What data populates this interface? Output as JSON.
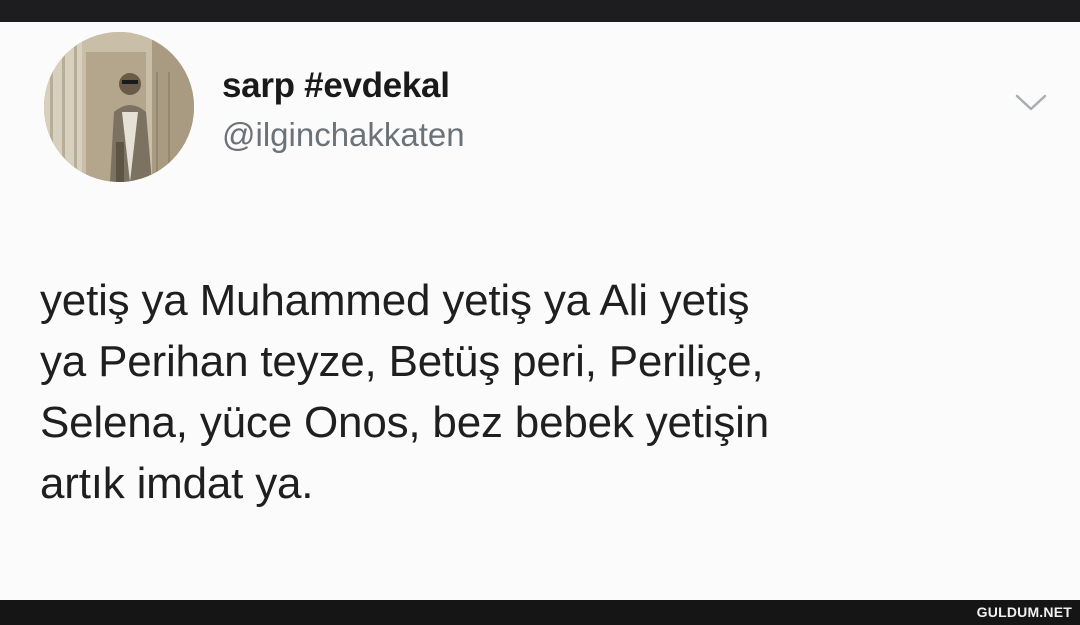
{
  "tweet": {
    "author": {
      "display_name": "sarp #evdekal",
      "handle": "@ilginchakkaten"
    },
    "menu_icon": "chevron-down-icon",
    "text_lines": [
      "yetiş ya Muhammed yetiş ya Ali yetiş",
      "ya Perihan teyze, Betüş peri, Periliçe,",
      "Selena, yüce Onos, bez bebek yetişin",
      "artık imdat ya."
    ]
  },
  "watermark": "GULDUM.NET",
  "colors": {
    "card_background": "#fbfbfb",
    "frame": "#1c1c1e",
    "display_name": "#1a1a1a",
    "handle": "#6b7278",
    "text": "#1f1f1f"
  }
}
